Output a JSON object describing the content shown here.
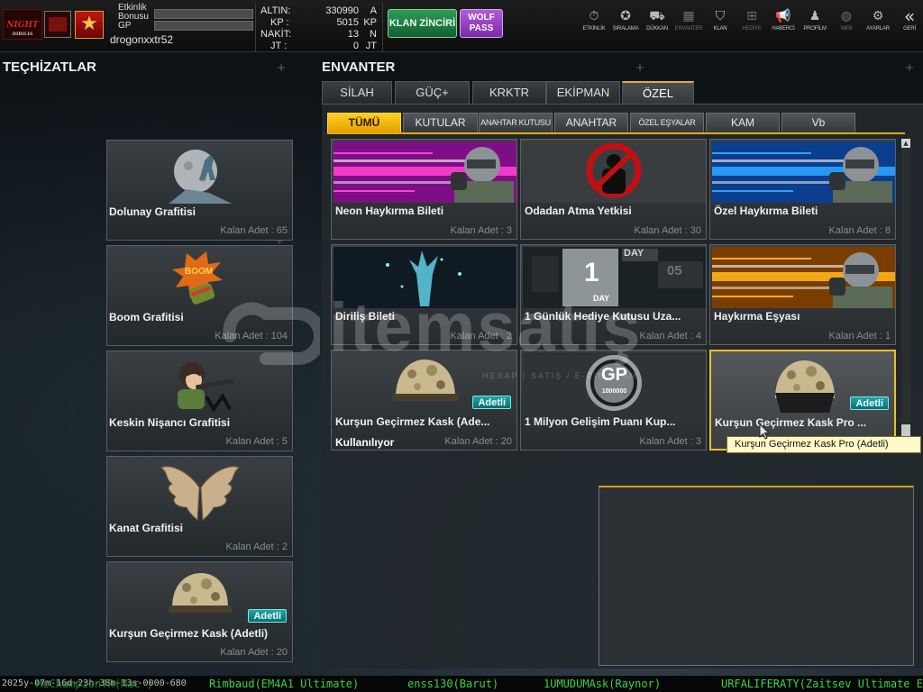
{
  "colors": {
    "accent": "#e5a100",
    "badge": "#0b6c72",
    "ticker_green": "#3fd23f",
    "tooltip_bg": "#fff9c9"
  },
  "profile": {
    "logo_text": "NIGHT",
    "logo_sub": "DIRILIS",
    "event_bonus_label": "Etkinlik Bonusu",
    "gp_label": "GP",
    "username": "drogonxxtr52"
  },
  "currency": [
    {
      "label": "ALTIN:",
      "value": "330990",
      "unit": "A"
    },
    {
      "label": "KP :",
      "value": "5015",
      "unit": "KP"
    },
    {
      "label": "NAKİT:",
      "value": "13",
      "unit": "N"
    },
    {
      "label": "JT :",
      "value": "0",
      "unit": "JT"
    }
  ],
  "buttons": {
    "klan": "KLAN ZİNCİRİ",
    "wolf_line1": "WOLF",
    "wolf_line2": "PASS"
  },
  "nav": [
    {
      "label": "ETKİNLİK",
      "icon": "stopwatch-icon",
      "glyph": "⏱",
      "dim": false
    },
    {
      "label": "SIRALAMA",
      "icon": "medal-icon",
      "glyph": "✪",
      "dim": false
    },
    {
      "label": "DÜKKAN",
      "icon": "cart-icon",
      "glyph": "⛟",
      "dim": false
    },
    {
      "label": "ENVANTER",
      "icon": "inventory-icon",
      "glyph": "▦",
      "dim": true
    },
    {
      "label": "KLAN",
      "icon": "shield-icon",
      "glyph": "⛉",
      "dim": false
    },
    {
      "label": "HEDİYE",
      "icon": "gift-icon",
      "glyph": "⊞",
      "dim": true
    },
    {
      "label": "HABERCİ",
      "icon": "megaphone-icon",
      "glyph": "📢",
      "dim": false
    },
    {
      "label": "PROFİLM",
      "icon": "profile-icon",
      "glyph": "♟",
      "dim": false
    },
    {
      "label": "WEB",
      "icon": "globe-icon",
      "glyph": "◍",
      "dim": true
    },
    {
      "label": "AYARLAR",
      "icon": "gear-icon",
      "glyph": "⚙",
      "dim": false
    },
    {
      "label": "GERİ",
      "icon": "back-icon",
      "glyph": "«",
      "dim": false
    }
  ],
  "left": {
    "title": "TEÇHİZATLAR",
    "items": [
      {
        "name": "Dolunay Grafitisi",
        "qty": "Kalan Adet : 65",
        "icon": "moon-graffiti-icon"
      },
      {
        "name": "Boom Grafitisi",
        "qty": "Kalan Adet : 104",
        "icon": "boom-graffiti-icon"
      },
      {
        "name": "Keskin Nişancı Grafitisi",
        "qty": "Kalan Adet : 5",
        "icon": "sniper-graffiti-icon"
      },
      {
        "name": "Kanat Grafitisi",
        "qty": "Kalan Adet : 2",
        "icon": "wings-graffiti-icon"
      },
      {
        "name": "Kurşun Geçirmez Kask (Adetli)",
        "qty": "Kalan Adet : 20",
        "icon": "helmet-icon",
        "badge": "Adetli"
      }
    ]
  },
  "inventory": {
    "title": "ENVANTER",
    "tabs": [
      "SİLAH",
      "GÜÇ+",
      "KRKTR",
      "EKİPMAN",
      "ÖZEL"
    ],
    "subtabs": [
      "TÜMÜ",
      "KUTULAR",
      "ANAHTAR KUTUSU",
      "ANAHTAR",
      "ÖZEL EŞYALAR",
      "KAM",
      "Vb"
    ],
    "items": [
      {
        "name": "Neon Haykırma Bileti",
        "qty": "Kalan Adet : 3",
        "icon": "neon-shout-ticket-icon"
      },
      {
        "name": "Odadan Atma Yetkisi",
        "qty": "Kalan Adet : 30",
        "icon": "kick-permission-icon"
      },
      {
        "name": "Özel Haykırma Bileti",
        "qty": "Kalan Adet : 8",
        "icon": "special-shout-ticket-icon"
      },
      {
        "name": "Diriliş Bileti",
        "qty": "Kalan Adet : 2",
        "icon": "revive-ticket-icon"
      },
      {
        "name": "1 Günlük Hediye Kutusu Uza...",
        "qty": "Kalan Adet : 4",
        "icon": "day-giftbox-icon",
        "day_top": "DAY",
        "day_num": "1",
        "day_bottom": "DAY",
        "day_side": "05"
      },
      {
        "name": "Haykırma Eşyası",
        "qty": "Kalan Adet : 1",
        "icon": "shout-item-icon"
      },
      {
        "name": "Kurşun Geçirmez Kask (Ade...",
        "qty": "Kalan Adet : 20",
        "icon": "helmet-icon",
        "badge": "Adetli",
        "status": "Kullanılıyor"
      },
      {
        "name": "1 Milyon Gelişim Puanı Kup...",
        "qty": "Kalan Adet : 3",
        "icon": "gp-coupon-icon",
        "coin_main": "GP",
        "coin_sub": "1000000"
      },
      {
        "name": "Kurşun Geçirmez Kask Pro ...",
        "qty": "",
        "icon": "helmet-pro-icon",
        "badge": "Adetli"
      }
    ],
    "tooltip": "Kurşun Geçirmez Kask Pro (Adetli)"
  },
  "watermark": {
    "text": "itemsatış",
    "sub": "HESAP / SATIŞ / E-PIN .COM"
  },
  "ticker": {
    "timestamp": "2025y-07m-16d-23h-38m-13s-0000-680",
    "messages": [
      "McChampionTR(Mac )",
      "Rimbaud(EM4A1 Ultimate)",
      "enss130(Barut)",
      "1UMUDUMAsk(Raynor)",
      "URFALIFERATY(Zaitsev Ultimate E"
    ]
  }
}
